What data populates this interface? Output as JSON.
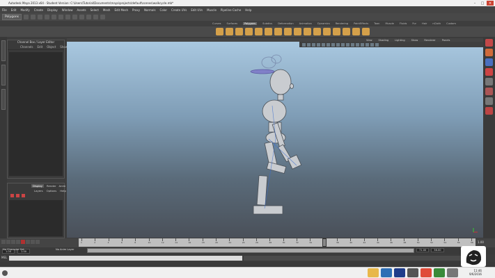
{
  "window": {
    "title": "Autodesk Maya 2013 x64 - Student Version: C:\\Users\\Tutorial\\Documents\\maya\\projects\\default\\scenes\\walkcycle.mb*",
    "controls": [
      "–",
      "□",
      "×"
    ]
  },
  "menubar": [
    "File",
    "Edit",
    "Modify",
    "Create",
    "Display",
    "Window",
    "Assets",
    "Select",
    "Mesh",
    "Edit Mesh",
    "Proxy",
    "Normals",
    "Color",
    "Create UVs",
    "Edit UVs",
    "Muscle",
    "Pipeline Cache",
    "Help"
  ],
  "statusline": {
    "mode": "Polygons"
  },
  "shelf_tabs": {
    "items": [
      "Curves",
      "Surfaces",
      "Polygons",
      "Subdivs",
      "Deformation",
      "Animation",
      "Dynamics",
      "Rendering",
      "PaintEffects",
      "Toon",
      "Muscle",
      "Fluids",
      "Fur",
      "Hair",
      "nCloth",
      "Custom"
    ],
    "active": "Polygons"
  },
  "outliner": {
    "title": "Channel Box / Layer Editor",
    "menu": [
      "Channels",
      "Edit",
      "Object",
      "Show"
    ]
  },
  "layers": {
    "tabs": [
      "Display",
      "Render",
      "Anim"
    ],
    "active_tab": "Display",
    "submenu": [
      "Layers",
      "Options",
      "Help"
    ]
  },
  "viewport": {
    "menu": [
      "View",
      "Shading",
      "Lighting",
      "Show",
      "Renderer",
      "Panels"
    ]
  },
  "timeline": {
    "ticks": [
      "1",
      "2",
      "4",
      "6",
      "8",
      "10",
      "12",
      "14",
      "16",
      "18",
      "20",
      "22",
      "24",
      "26",
      "28",
      "30",
      "32",
      "34",
      "36",
      "38",
      "40",
      "42",
      "44",
      "46",
      "48",
      "50",
      "52",
      "54",
      "56",
      "58"
    ],
    "current_frame": "1.00"
  },
  "range": {
    "start": "1.00",
    "inner_start": "1.00",
    "inner_end": "71.00",
    "end": "36.00",
    "anim_layer": "No Anim Layer",
    "char_set": "No Character Set"
  },
  "cmdline": {
    "label": "MEL"
  },
  "colors": {
    "accent": "#d4a04a",
    "viewport_top": "#a9c8e0",
    "viewport_bottom": "#4a5059"
  },
  "taskbar": {
    "time": "11:46",
    "date": "9/6/2016"
  }
}
